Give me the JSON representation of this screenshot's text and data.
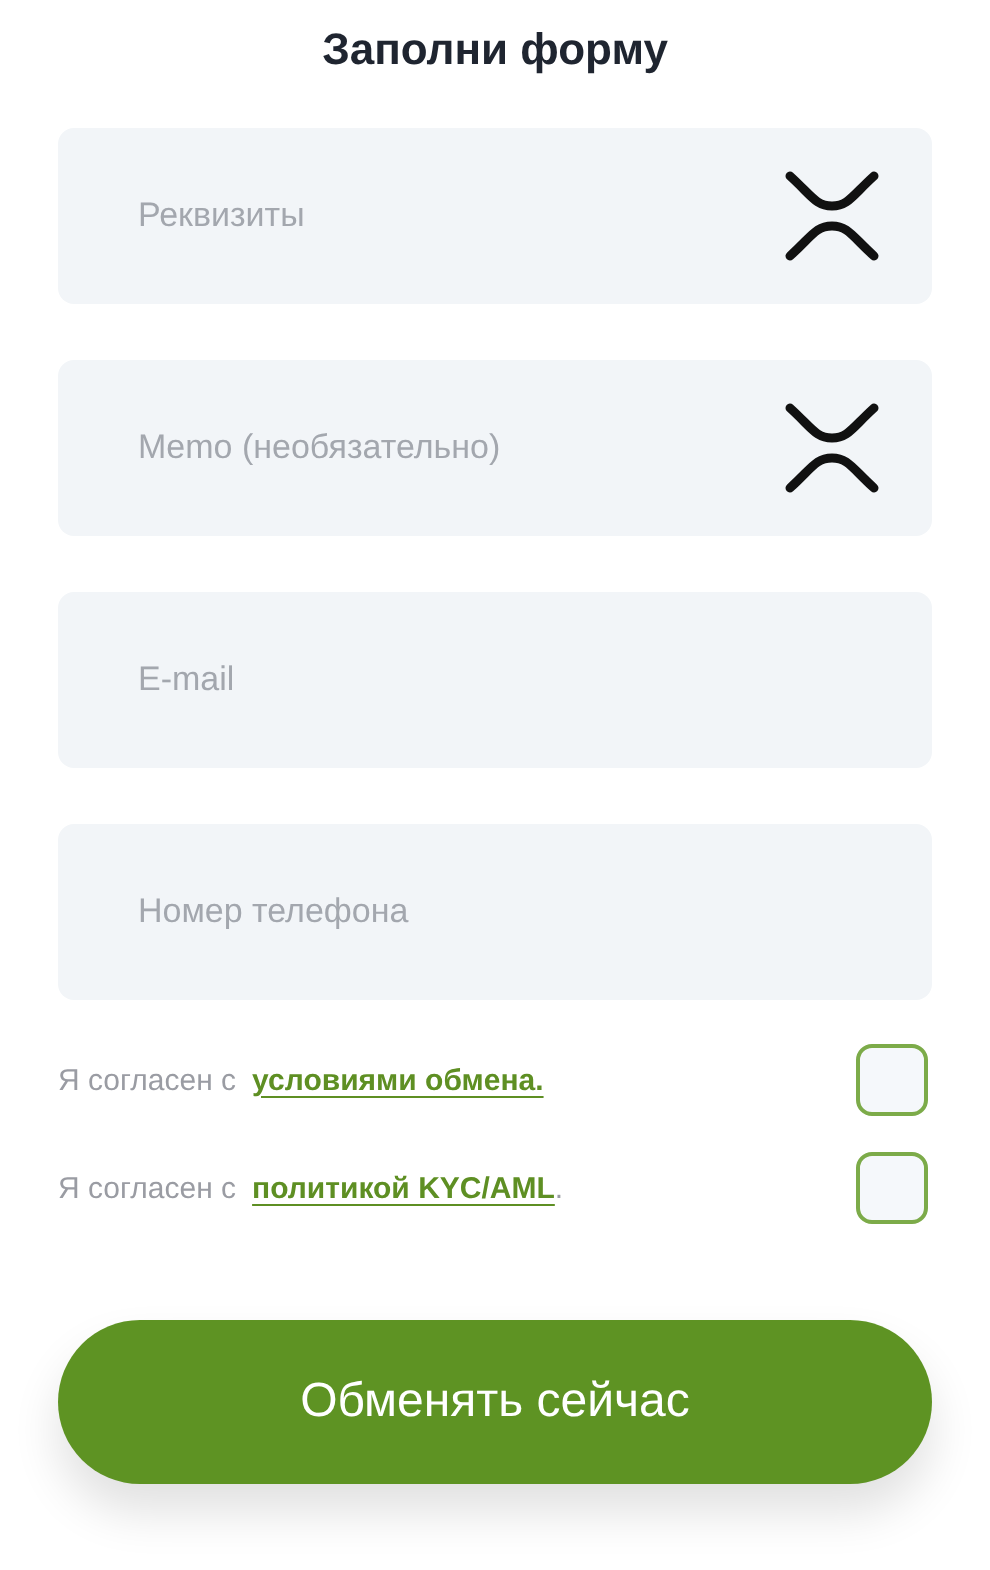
{
  "title": "Заполни форму",
  "fields": [
    {
      "placeholder": "Реквизиты",
      "kind": "with-icon"
    },
    {
      "placeholder": "Memo (необязательно)",
      "kind": "with-icon"
    },
    {
      "placeholder": "E-mail",
      "kind": "plain"
    },
    {
      "placeholder": "Номер телефона",
      "kind": "plain"
    }
  ],
  "agreements": [
    {
      "prefix": "Я согласен с",
      "link": "условиями обмена.",
      "checked": false
    },
    {
      "prefix": "Я согласен с",
      "link": "политикой KYC/AML",
      "suffix": ".",
      "checked": false
    }
  ],
  "submit": "Обменять сейчас"
}
